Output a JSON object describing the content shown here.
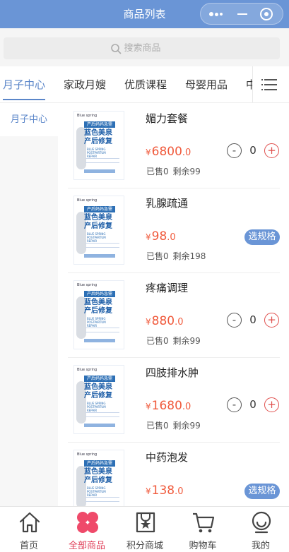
{
  "header": {
    "title": "商品列表"
  },
  "search": {
    "placeholder": "搜索商品"
  },
  "categories": [
    {
      "label": "月子中心",
      "active": true
    },
    {
      "label": "家政月嫂"
    },
    {
      "label": "优质课程"
    },
    {
      "label": "母婴用品"
    },
    {
      "label": "中"
    }
  ],
  "side": {
    "items": [
      {
        "label": "月子中心",
        "active": true
      }
    ]
  },
  "thumb": {
    "brand": "Blue spring",
    "band": "产后妈妈急需",
    "line1": "蓝色美泉",
    "line2": "产后修复",
    "sub": "BLUE SPRING POSTPARTUM REPAIR"
  },
  "products": [
    {
      "name": "媚力套餐",
      "currency": "¥",
      "price_int": "6800",
      "price_dec": ".0",
      "sold": "已售0",
      "left": "剩余99",
      "action": "qty",
      "qty": "0"
    },
    {
      "name": "乳腺疏通",
      "currency": "¥",
      "price_int": "98",
      "price_dec": ".0",
      "sold": "已售0",
      "left": "剩余198",
      "action": "spec",
      "spec_label": "选规格"
    },
    {
      "name": "疼痛调理",
      "currency": "¥",
      "price_int": "880",
      "price_dec": ".0",
      "sold": "已售0",
      "left": "剩余99",
      "action": "qty",
      "qty": "0"
    },
    {
      "name": "四肢排水肿",
      "currency": "¥",
      "price_int": "1680",
      "price_dec": ".0",
      "sold": "已售0",
      "left": "剩余99",
      "action": "qty",
      "qty": "0"
    },
    {
      "name": "中药泡发",
      "currency": "¥",
      "price_int": "138",
      "price_dec": ".0",
      "sold": "",
      "left": "",
      "action": "spec",
      "spec_label": "选规格"
    }
  ],
  "qty_controls": {
    "minus": "-",
    "plus": "+"
  },
  "tabbar": [
    {
      "label": "首页",
      "icon": "home-icon"
    },
    {
      "label": "全部商品",
      "icon": "grid-icon",
      "active": true
    },
    {
      "label": "积分商城",
      "icon": "points-bag-icon"
    },
    {
      "label": "购物车",
      "icon": "cart-icon"
    },
    {
      "label": "我的",
      "icon": "profile-icon"
    }
  ],
  "colors": {
    "primary": "#6a95d6",
    "accent_red": "#e0405a",
    "price": "#f05a3c"
  }
}
